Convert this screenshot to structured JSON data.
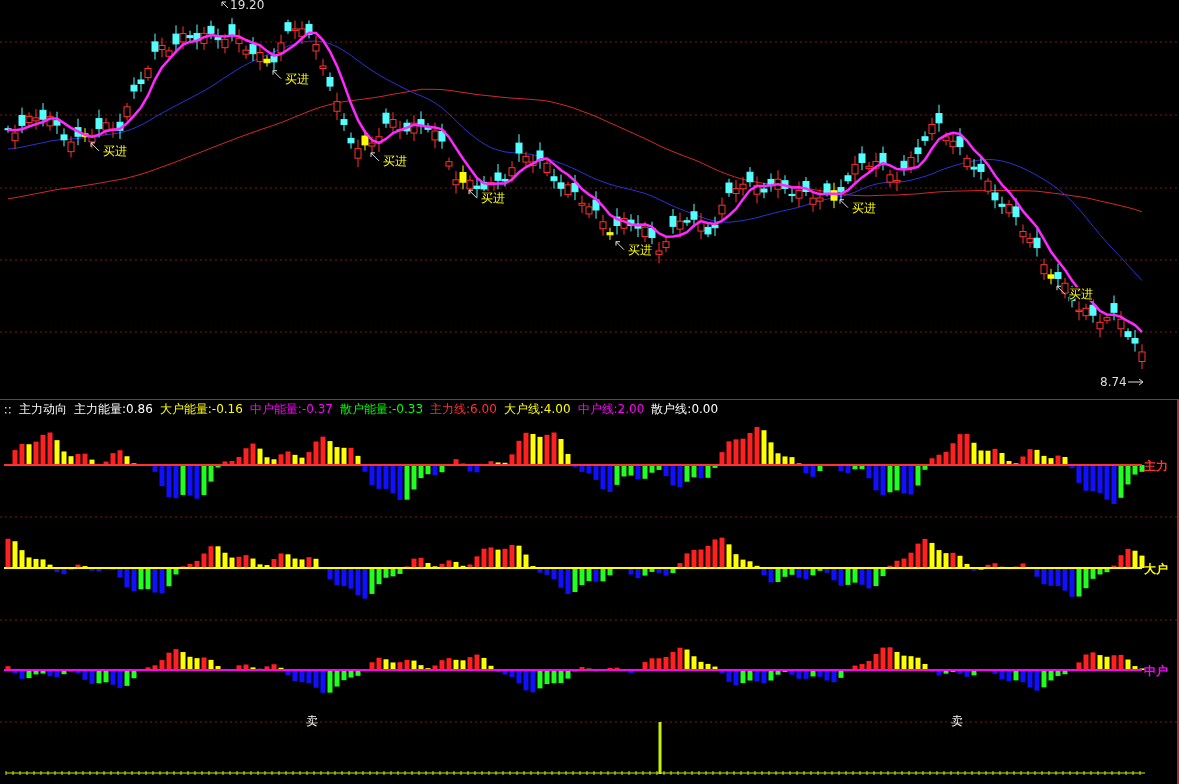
{
  "price_chart": {
    "high_label": "19.20",
    "low_label": "8.74",
    "signals": [
      {
        "label": "买进"
      },
      {
        "label": "买进"
      },
      {
        "label": "买进"
      },
      {
        "label": "买进"
      },
      {
        "label": "买进"
      },
      {
        "label": "买进"
      },
      {
        "label": "买进"
      }
    ]
  },
  "indicator": {
    "title": "主力动向",
    "legend": [
      {
        "text": "主力能量:0.86",
        "color": "#ffffff"
      },
      {
        "text": "大户能量:-0.16",
        "color": "#ffff00"
      },
      {
        "text": "中户能量:-0.37",
        "color": "#ff00ff"
      },
      {
        "text": "散户能量:-0.33",
        "color": "#00ff00"
      },
      {
        "text": "主力线:6.00",
        "color": "#ff3232"
      },
      {
        "text": "大户线:4.00",
        "color": "#ffff00"
      },
      {
        "text": "中户线:2.00",
        "color": "#ff00ff"
      },
      {
        "text": "散户线:0.00",
        "color": "#ffffff"
      }
    ],
    "panels": [
      {
        "label": "主力",
        "color": "#ff3232"
      },
      {
        "label": "大户",
        "color": "#ffff00"
      },
      {
        "label": "中户",
        "color": "#ff00ff"
      }
    ],
    "sell_signals": [
      {
        "label": "卖"
      },
      {
        "label": "卖"
      }
    ]
  }
}
